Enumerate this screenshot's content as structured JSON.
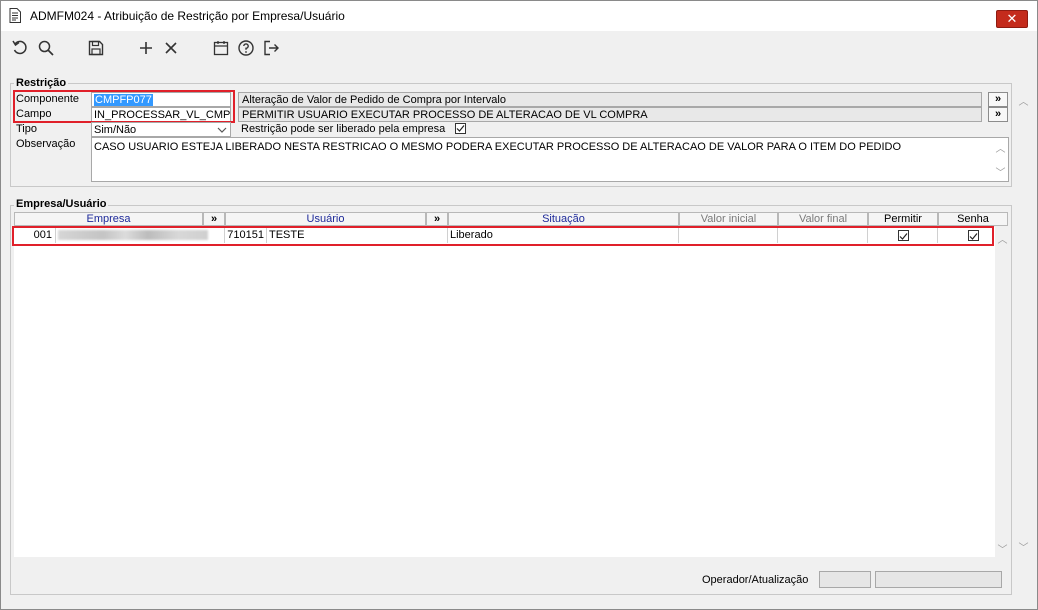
{
  "window": {
    "title": "ADMFM024 - Atribuição de Restrição por Empresa/Usuário",
    "close_label": "✕"
  },
  "toolbar": {
    "icons": [
      "undo-icon",
      "search-icon",
      "save-icon",
      "add-icon",
      "delete-icon",
      "calendar-icon",
      "help-icon",
      "exit-icon"
    ]
  },
  "restricao": {
    "group_label": "Restrição",
    "componente_label": "Componente",
    "componente_value": "CMPFP077",
    "componente_desc": "Alteração de Valor de Pedido de Compra por Intervalo",
    "campo_label": "Campo",
    "campo_value": "IN_PROCESSAR_VL_CMP",
    "campo_desc": "PERMITIR USUARIO EXECUTAR PROCESSO DE ALTERACAO DE VL COMPRA",
    "tipo_label": "Tipo",
    "tipo_value": "Sim/Não",
    "liberado_label": "Restrição pode ser liberado pela empresa",
    "liberado_checked": true,
    "observacao_label": "Observação",
    "observacao_value": "CASO USUARIO ESTEJA LIBERADO NESTA RESTRICAO O MESMO PODERA EXECUTAR PROCESSO DE ALTERACAO DE VALOR PARA O ITEM DO PEDIDO",
    "more_button": "»"
  },
  "empresa_usuario": {
    "group_label": "Empresa/Usuário",
    "columns": {
      "empresa": "Empresa",
      "usuario": "Usuário",
      "situacao": "Situação",
      "valor_inicial": "Valor inicial",
      "valor_final": "Valor final",
      "permitir": "Permitir",
      "senha": "Senha",
      "more": "»"
    },
    "rows": [
      {
        "empresa_code": "001",
        "usuario_code": "710151",
        "usuario_name": "TESTE",
        "situacao": "Liberado",
        "valor_inicial": "",
        "valor_final": "",
        "permitir": true,
        "senha": true
      }
    ]
  },
  "status": {
    "operador_label": "Operador/Atualização"
  },
  "colors": {
    "highlight_border": "#e0202a",
    "selection": "#3399ff",
    "close_button": "#c42b1c",
    "header_blue_text": "#1e2a9a"
  }
}
